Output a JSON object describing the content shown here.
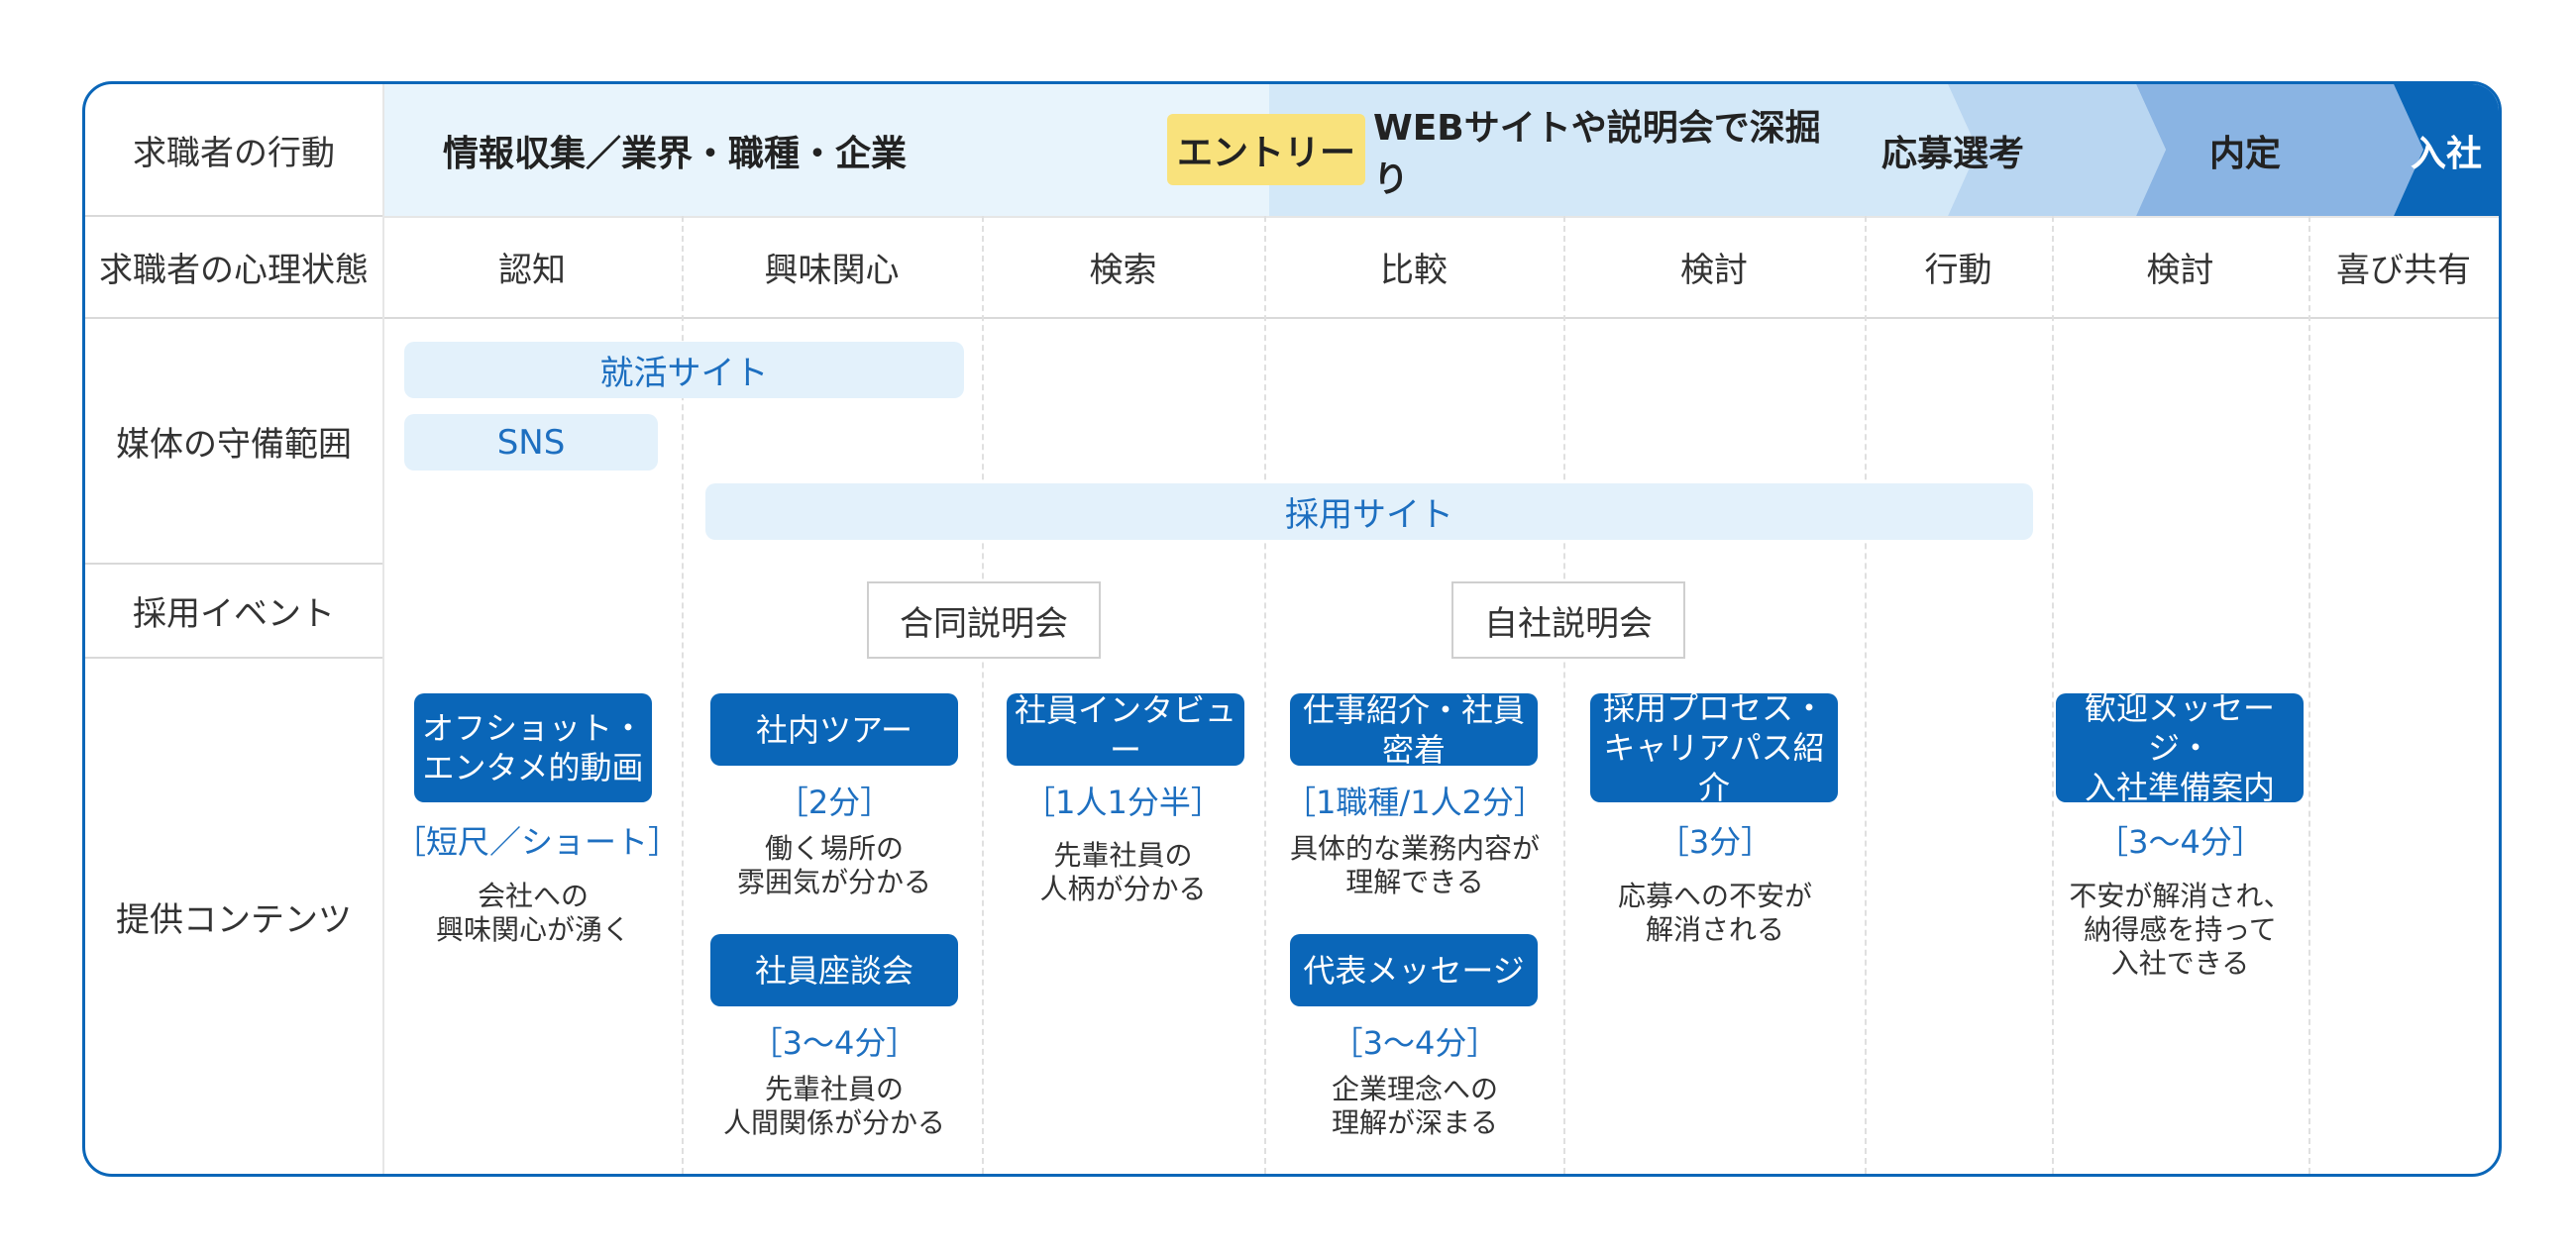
{
  "rows": {
    "behavior": "求職者の行動",
    "psychology": "求職者の心理状態",
    "media": "媒体の守備範囲",
    "events": "採用イベント",
    "contents": "提供コンテンツ"
  },
  "header": {
    "info": "情報収集／業界・職種・企業",
    "entry": "エントリー",
    "deep": "WEBサイトや説明会で深掘り",
    "apply": "応募選考",
    "offer": "内定",
    "join": "入社"
  },
  "psych": [
    "認知",
    "興味関心",
    "検索",
    "比較",
    "検討",
    "行動",
    "検討",
    "喜び共有"
  ],
  "media": {
    "shukatsu": "就活サイト",
    "sns": "SNS",
    "saiyo": "採用サイト"
  },
  "events": {
    "joint": "合同説明会",
    "own": "自社説明会"
  },
  "contents": {
    "c1": {
      "title": "オフショット・\nエンタメ的動画",
      "duration": "［短尺／ショート］",
      "desc": "会社への\n興味関心が湧く"
    },
    "c2": {
      "title": "社内ツアー",
      "duration": "［2分］",
      "desc": "働く場所の\n雰囲気が分かる"
    },
    "c3": {
      "title": "社員座談会",
      "duration": "［3〜4分］",
      "desc": "先輩社員の\n人間関係が分かる"
    },
    "c4": {
      "title": "社員インタビュー",
      "duration": "［1人1分半］",
      "desc": "先輩社員の\n人柄が分かる"
    },
    "c5": {
      "title": "仕事紹介・社員密着",
      "duration": "［1職種/1人2分］",
      "desc": "具体的な業務内容が\n理解できる"
    },
    "c6": {
      "title": "代表メッセージ",
      "duration": "［3〜4分］",
      "desc": "企業理念への\n理解が深まる"
    },
    "c7": {
      "title": "採用プロセス・\nキャリアパス紹介",
      "duration": "［3分］",
      "desc": "応募への不安が\n解消される"
    },
    "c8": {
      "title": "歓迎メッセージ・\n入社準備案内",
      "duration": "［3〜4分］",
      "desc": "不安が解消され、\n納得感を持って\n入社できる"
    }
  },
  "colors": {
    "frame": "#0a66b8",
    "band_light": "#e8f4fc",
    "band_mid": "#d3e8f8",
    "band_apply": "#b9d6f1",
    "band_offer": "#8ab4e3",
    "band_join": "#0a66b8",
    "entry_badge": "#f9e27c",
    "media_bar": "#e3f1fb",
    "content_button": "#0a66b8"
  }
}
